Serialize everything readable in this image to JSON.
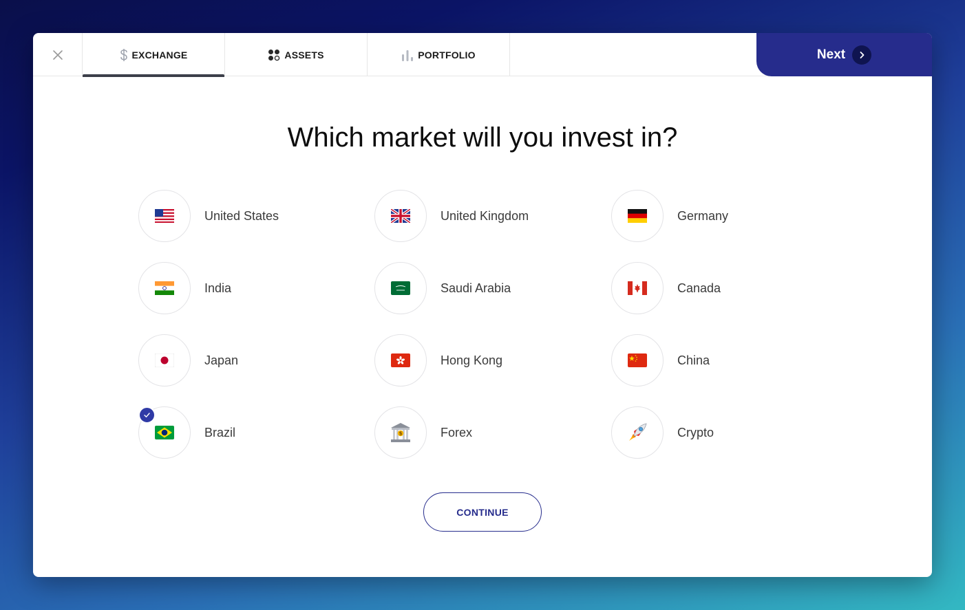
{
  "header": {
    "tabs": [
      {
        "label": "EXCHANGE",
        "icon": "dollar-icon",
        "active": true
      },
      {
        "label": "ASSETS",
        "icon": "assets-dots-icon",
        "active": false
      },
      {
        "label": "PORTFOLIO",
        "icon": "bar-chart-icon",
        "active": false
      }
    ],
    "next_label": "Next"
  },
  "main": {
    "title": "Which market will you invest in?",
    "options": [
      {
        "label": "United States",
        "icon": "us-flag-icon",
        "selected": false
      },
      {
        "label": "United Kingdom",
        "icon": "uk-flag-icon",
        "selected": false
      },
      {
        "label": "Germany",
        "icon": "germany-flag-icon",
        "selected": false
      },
      {
        "label": "India",
        "icon": "india-flag-icon",
        "selected": false
      },
      {
        "label": "Saudi Arabia",
        "icon": "saudi-arabia-flag-icon",
        "selected": false
      },
      {
        "label": "Canada",
        "icon": "canada-flag-icon",
        "selected": false
      },
      {
        "label": "Japan",
        "icon": "japan-flag-icon",
        "selected": false
      },
      {
        "label": "Hong Kong",
        "icon": "hong-kong-flag-icon",
        "selected": false
      },
      {
        "label": "China",
        "icon": "china-flag-icon",
        "selected": false
      },
      {
        "label": "Brazil",
        "icon": "brazil-flag-icon",
        "selected": true
      },
      {
        "label": "Forex",
        "icon": "bank-icon",
        "selected": false
      },
      {
        "label": "Crypto",
        "icon": "rocket-icon",
        "selected": false
      }
    ],
    "continue_label": "CONTINUE"
  },
  "colors": {
    "accent": "#262c8c",
    "selected_badge": "#2f3aa6"
  }
}
